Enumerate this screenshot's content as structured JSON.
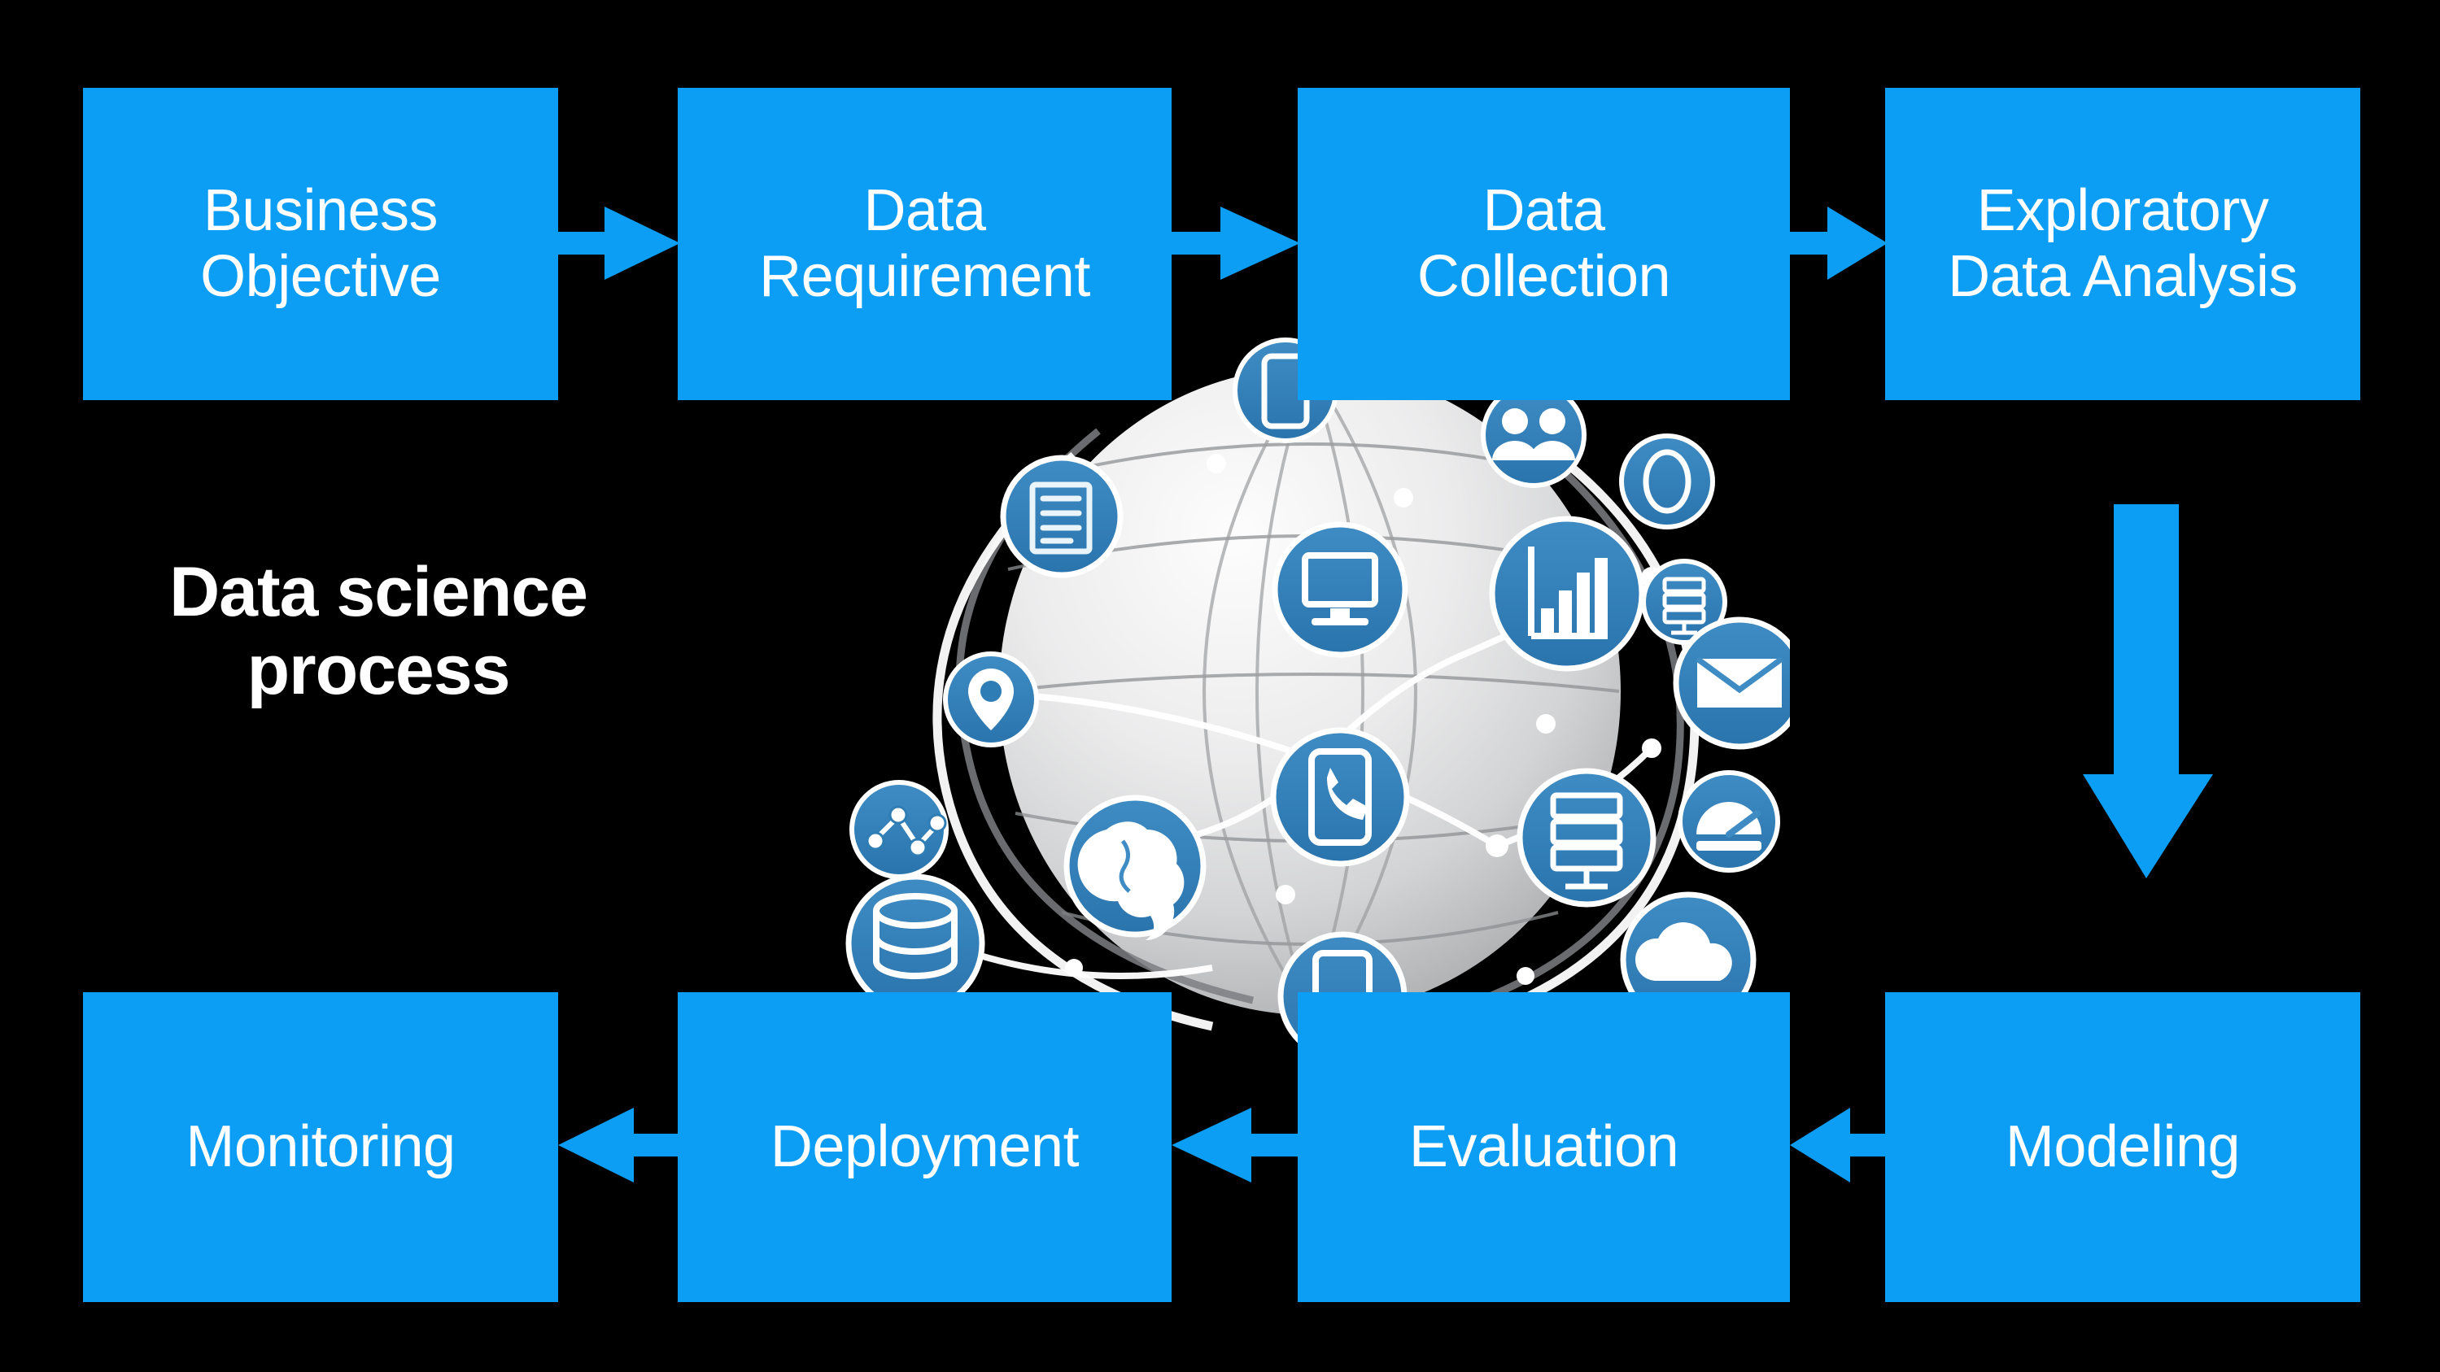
{
  "canvas": {
    "background": "#000000",
    "accent": "#0c9ef5",
    "text_color": "#ffffff",
    "icon_blue": "#2e7db5",
    "icon_blue_light": "#4b91c4"
  },
  "title": {
    "text": "Data science\nprocess"
  },
  "flow": {
    "top_row": [
      {
        "id": "business-objective",
        "label": "Business\nObjective"
      },
      {
        "id": "data-requirement",
        "label": "Data\nRequirement"
      },
      {
        "id": "data-collection",
        "label": "Data\nCollection"
      },
      {
        "id": "exploratory-data-analysis",
        "label": "Exploratory\nData Analysis"
      }
    ],
    "bottom_row": [
      {
        "id": "monitoring",
        "label": "Monitoring"
      },
      {
        "id": "deployment",
        "label": "Deployment"
      },
      {
        "id": "evaluation",
        "label": "Evaluation"
      },
      {
        "id": "modeling",
        "label": "Modeling"
      }
    ],
    "arrows": [
      {
        "id": "bo-to-dr",
        "direction": "right",
        "from": "Business Objective",
        "to": "Data Requirement"
      },
      {
        "id": "dr-to-dc",
        "direction": "right",
        "from": "Data Requirement",
        "to": "Data Collection"
      },
      {
        "id": "dc-to-eda",
        "direction": "right",
        "from": "Data Collection",
        "to": "Exploratory Data Analysis"
      },
      {
        "id": "eda-to-modeling",
        "direction": "down",
        "from": "Exploratory Data Analysis",
        "to": "Modeling"
      },
      {
        "id": "modeling-to-evaluation",
        "direction": "left",
        "from": "Modeling",
        "to": "Evaluation"
      },
      {
        "id": "evaluation-to-deployment",
        "direction": "left",
        "from": "Evaluation",
        "to": "Deployment"
      },
      {
        "id": "deployment-to-monitoring",
        "direction": "left",
        "from": "Deployment",
        "to": "Monitoring"
      }
    ]
  },
  "graphic": {
    "name": "network-globe-illustration",
    "description": "Grey 3D globe with latitude/longitude lines and white connection lines linking blue circular technology icons",
    "icons": [
      "document-icon",
      "location-pin-icon",
      "network-graph-icon",
      "database-stack-icon",
      "user-profile-icon",
      "scatter-chart-icon",
      "brain-icon",
      "desktop-monitor-icon",
      "smartphone-call-icon",
      "tablet-icon",
      "laptop-icon",
      "bar-chart-icon",
      "people-group-icon",
      "oval-icon",
      "server-rack-small-icon",
      "envelope-icon",
      "server-rack-icon",
      "gauge-icon",
      "cloud-icon",
      "wifi-router-icon",
      "mobile-top-icon",
      "card-icon"
    ]
  }
}
